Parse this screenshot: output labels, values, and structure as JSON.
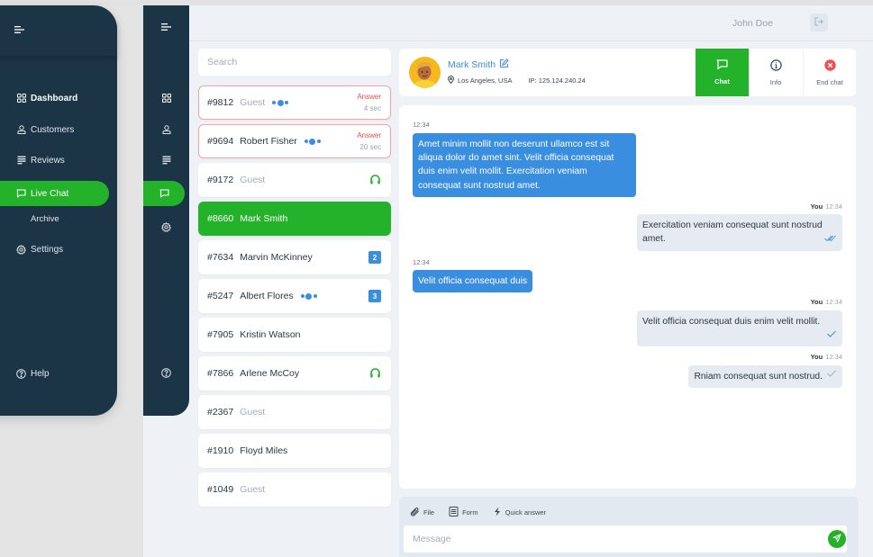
{
  "sidebar": {
    "items": [
      {
        "id": "dashboard",
        "label": "Dashboard",
        "icon": "grid-icon"
      },
      {
        "id": "customers",
        "label": "Customers",
        "icon": "user-icon"
      },
      {
        "id": "reviews",
        "label": "Reviews",
        "icon": "reviews-icon"
      },
      {
        "id": "live-chat",
        "label": "Live Chat",
        "icon": "chat-icon",
        "active": true
      },
      {
        "id": "settings",
        "label": "Settings",
        "icon": "gear-icon"
      }
    ],
    "sub_items": [
      {
        "label": "Archive"
      }
    ],
    "help_label": "Help"
  },
  "topbar": {
    "user_name": "John Doe",
    "logout_icon": "logout-icon"
  },
  "chat_list": {
    "search_placeholder": "Search",
    "items": [
      {
        "id": "#9812",
        "name": "Guest",
        "guest": true,
        "typing": true,
        "alert": true,
        "answer_label": "Answer",
        "wait": "4 sec"
      },
      {
        "id": "#9694",
        "name": "Robert Fisher",
        "guest": false,
        "typing": true,
        "alert": true,
        "answer_label": "Answer",
        "wait": "20 sec"
      },
      {
        "id": "#9172",
        "name": "Guest",
        "guest": true,
        "status_icon": "headset-icon"
      },
      {
        "id": "#8660",
        "name": "Mark Smith",
        "selected": true
      },
      {
        "id": "#7634",
        "name": "Marvin McKinney",
        "unread": "2"
      },
      {
        "id": "#5247",
        "name": "Albert Flores",
        "typing": true,
        "unread": "3"
      },
      {
        "id": "#7905",
        "name": "Kristin Watson"
      },
      {
        "id": "#7866",
        "name": "Arlene McCoy",
        "status_icon": "headset-icon"
      },
      {
        "id": "#2367",
        "name": "Guest",
        "guest": true
      },
      {
        "id": "#1910",
        "name": "Floyd Miles"
      },
      {
        "id": "#1049",
        "name": "Guest",
        "guest": true
      }
    ]
  },
  "chat_header": {
    "contact_name": "Mark Smith",
    "location": "Los Angeles, USA",
    "ip": "IP: 125.124.240.24",
    "buttons": [
      {
        "label": "Chat",
        "icon": "chat-icon",
        "active": true
      },
      {
        "label": "Info",
        "icon": "info-icon"
      },
      {
        "label": "End chat",
        "icon": "close-circle-icon"
      }
    ]
  },
  "messages": [
    {
      "direction": "in",
      "time": "12:34",
      "text": "Amet minim mollit non deserunt ullamco est sit aliqua dolor do amet sint. Velit officia consequat duis enim velit mollit. Exercitation veniam consequat sunt nostrud amet."
    },
    {
      "direction": "out",
      "sender": "You",
      "time": "12:34",
      "text": "Exercitation veniam consequat sunt nostrud amet.",
      "status": "read"
    },
    {
      "direction": "in",
      "time": "12:34",
      "text": "Velit officia consequat duis"
    },
    {
      "direction": "out",
      "sender": "You",
      "time": "12:34",
      "text": "Velit officia consequat duis enim velit mollit.",
      "status": "delivered"
    },
    {
      "direction": "out",
      "sender": "You",
      "time": "12:34",
      "text": "Rniam consequat sunt nostrud.",
      "status": "sent"
    }
  ],
  "composer": {
    "tools": [
      {
        "label": "File",
        "icon": "paperclip-icon"
      },
      {
        "label": "Form",
        "icon": "form-icon"
      },
      {
        "label": "Quick answer",
        "icon": "lightning-icon"
      }
    ],
    "placeholder": "Message",
    "value": ""
  },
  "colors": {
    "navy": "#1b3547",
    "green": "#25b22b",
    "blue": "#3a8ee0",
    "alert_red": "#e94c4c"
  }
}
